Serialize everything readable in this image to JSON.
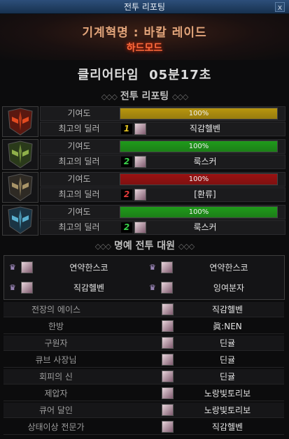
{
  "window": {
    "title": "전투 리포팅",
    "close_label": "x"
  },
  "header": {
    "raid_title": "기계혁명 : 바칼 레이드",
    "mode": "하드모드"
  },
  "clear": {
    "label": "클리어타임",
    "time": "05분17초"
  },
  "report_section": {
    "title": "전투 리포팅",
    "deco_left": "◇◇◇",
    "deco_right": "◇◇◇"
  },
  "labels": {
    "contribution": "기여도",
    "top_dealer": "최고의 딜러"
  },
  "players": [
    {
      "contribution_text": "100%",
      "contribution_value": 1.0,
      "bar_color": "#b8960e",
      "rank": "1",
      "rank_color": "#e0c020",
      "dealer": "직감헬벤"
    },
    {
      "contribution_text": "100%",
      "contribution_value": 1.0,
      "bar_color": "#1f9a1a",
      "rank": "2",
      "rank_color": "#39d24a",
      "dealer": "룩스커"
    },
    {
      "contribution_text": "100%",
      "contribution_value": 1.0,
      "bar_color": "#9a1111",
      "rank": "2",
      "rank_color": "#e23a3a",
      "dealer": "[환류]"
    },
    {
      "contribution_text": "100%",
      "contribution_value": 1.0,
      "bar_color": "#1f9a1a",
      "rank": "2",
      "rank_color": "#39d24a",
      "dealer": "룩스커"
    }
  ],
  "honor_section": {
    "title": "명예 전투 대원",
    "deco_left": "◇◇◇",
    "deco_right": "◇◇◇"
  },
  "honor": [
    "연약한스코",
    "연약한스코",
    "직감헬벤",
    "잉여분자"
  ],
  "awards": [
    {
      "title": "전장의 에이스",
      "name": "직감헬벤"
    },
    {
      "title": "한방",
      "name": "眞:NEN"
    },
    {
      "title": "구원자",
      "name": "딘귤"
    },
    {
      "title": "큐브 사장님",
      "name": "딘귤"
    },
    {
      "title": "회피의 신",
      "name": "딘귤"
    },
    {
      "title": "제압자",
      "name": "노랑빛토리보"
    },
    {
      "title": "큐어 달인",
      "name": "노랑빛토리보"
    },
    {
      "title": "상태이상 전문가",
      "name": "직감헬벤"
    }
  ],
  "colors": {
    "accent": "#ff6b3d",
    "raid_title": "#e1a47a"
  }
}
